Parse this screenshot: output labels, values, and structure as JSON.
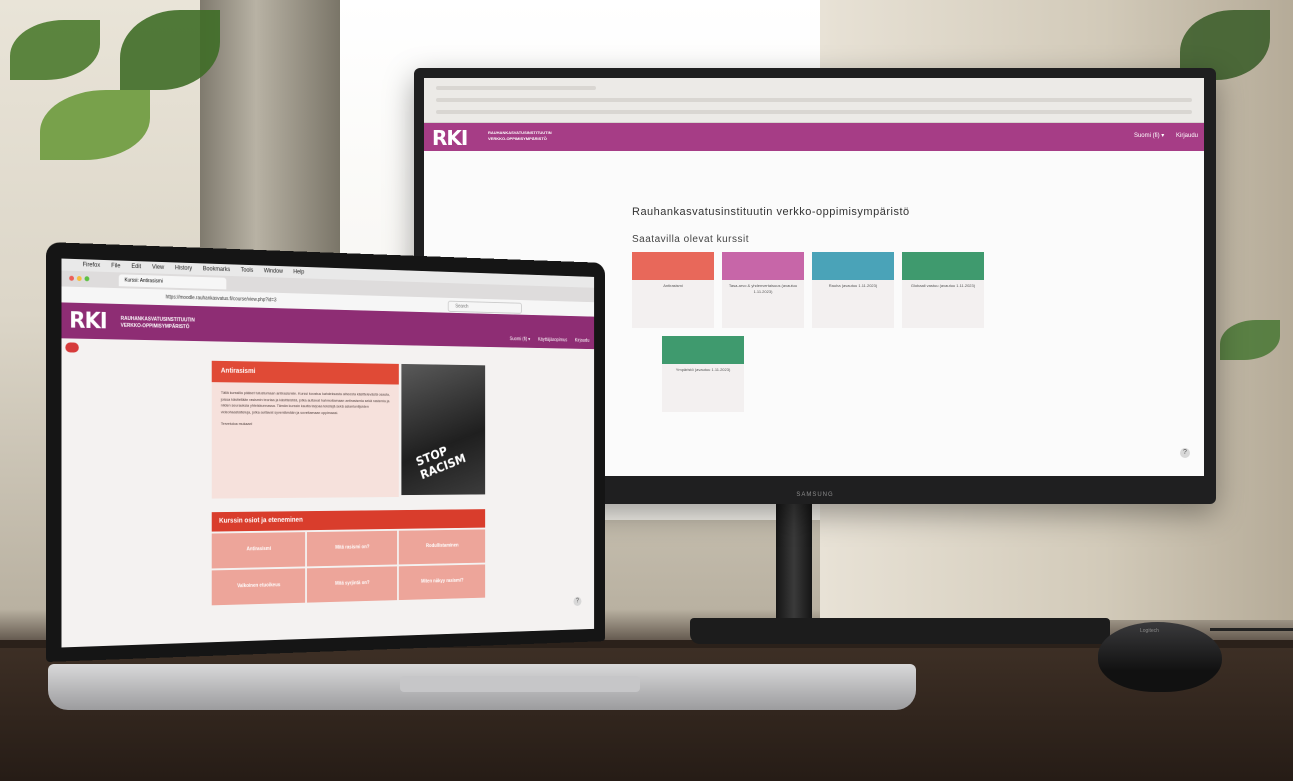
{
  "monitor": {
    "brand": "SAMSUNG",
    "site_logo": "RKI",
    "site_name_line1": "RAUHANKASVATUSINSTITUUTIN",
    "site_name_line2": "VERKKO-OPPIMISYMPÄRISTÖ",
    "language": "Suomi (fi) ▾",
    "login": "Kirjaudu",
    "page_title": "Rauhankasvatusinstituutin verkko-oppimisympäristö",
    "section_title": "Saatavilla olevat kurssit",
    "courses": [
      {
        "label": "Antirasismi",
        "color": "#e8685a"
      },
      {
        "label": "Tasa-arvo & yhdenvertaisuus (avautuu 1.11.2023)",
        "color": "#c766a8"
      },
      {
        "label": "Rauha (avautuu 1.11.2023)",
        "color": "#4aa3b8"
      },
      {
        "label": "Globaali vastuu (avautuu 1.11.2023)",
        "color": "#3f9a6e"
      },
      {
        "label": "Ympäristö (avautuu 1.11.2023)",
        "color": "#3f9a6e"
      }
    ],
    "help": "?"
  },
  "laptop": {
    "menu": [
      "Firefox",
      "File",
      "Edit",
      "View",
      "History",
      "Bookmarks",
      "Tools",
      "Window",
      "Help"
    ],
    "tab_title": "Kurssi: Antirasismi",
    "url": "https://moodle.rauhankasvatus.fi/course/view.php?id=3",
    "search_placeholder": "Search",
    "site_logo": "RKI",
    "site_name_line1": "RAUHANKASVATUSINSTITUUTIN",
    "site_name_line2": "VERKKO-OPPIMISYMPÄRISTÖ",
    "nav": [
      "Suomi (fi) ▾",
      "Käyttäjäsopimus",
      "Kirjaudu"
    ],
    "course_title": "Antirasismi",
    "course_text": "Tällä kurssilla pääset tutustumaan antirasismiin. Kurssi koostuu kahdeksasta aiheesta käsittelevästä osasta, joissa käsitellään rasismin teoriaa ja käsitteistöä, jotka auttavat hahmottamaan antirasismia sekä rasismia ja niiden seurauksia yhteiskunnassa. Tämän kurssin kautta tarjoaa tekstejä sekä asiantuntijoiden videohaastatteluja, jotka auttavat syventämään ja soveltamaan oppimaasi.",
    "course_welcome": "Tervetuloa mukaan!",
    "image_text": "STOP RACISM",
    "sections_title": "Kurssin osiot ja eteneminen",
    "sections": [
      "Antirasismi",
      "Mitä rasismi on?",
      "Rodullistaminen",
      "Valkoinen etuoikeus",
      "Mitä syrjintä on?",
      "Miten näkyy rasismi?"
    ],
    "help": "?"
  },
  "mouse_brand": "Logitech"
}
